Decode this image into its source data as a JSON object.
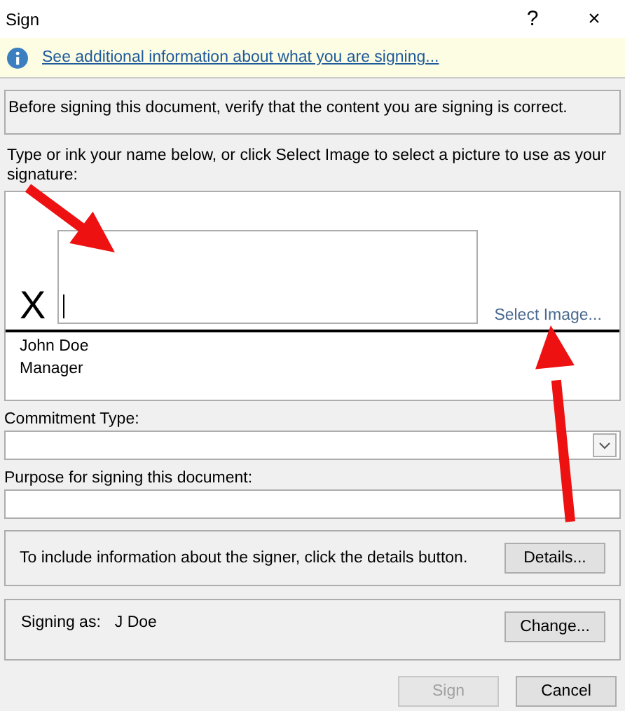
{
  "window": {
    "title": "Sign",
    "help": "?",
    "close": "×"
  },
  "info_bar": {
    "link": "See additional information about what you are signing..."
  },
  "notice": "Before signing this document, verify that the content you are signing is correct.",
  "instruction": "Type or ink your name below, or click Select Image to select a picture to use as your signature:",
  "signature": {
    "mark": "X",
    "select_image": "Select Image...",
    "signer_name": "John Doe",
    "signer_title": "Manager"
  },
  "commitment_type": {
    "label": "Commitment Type:"
  },
  "purpose": {
    "label": "Purpose for signing this document:"
  },
  "details": {
    "text": "To include information about the signer, click the details button.",
    "button": "Details..."
  },
  "signing_as": {
    "label": "Signing as:",
    "name": "J Doe",
    "button": "Change..."
  },
  "buttons": [
    {
      "label": "Sign",
      "disabled": true
    },
    {
      "label": "Cancel",
      "disabled": false
    }
  ],
  "annotations": [
    {
      "kind": "arrow"
    },
    {
      "kind": "arrow"
    }
  ]
}
